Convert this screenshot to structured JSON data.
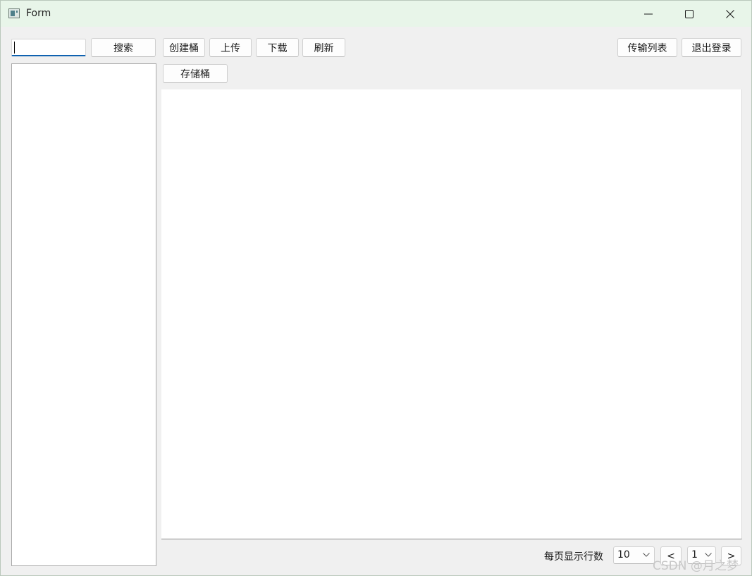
{
  "window": {
    "title": "Form",
    "icons": {
      "app": "app-icon",
      "minimize": "minimize-icon",
      "maximize": "maximize-icon",
      "close": "close-icon"
    }
  },
  "toolbar": {
    "search_value": "",
    "search_label": "搜索",
    "create_bucket_label": "创建桶",
    "upload_label": "上传",
    "download_label": "下载",
    "refresh_label": "刷新",
    "transfer_list_label": "传输列表",
    "logout_label": "退出登录"
  },
  "tabs": {
    "storage_bucket_label": "存储桶"
  },
  "sidebar": {
    "buckets": []
  },
  "table": {
    "rows": []
  },
  "pagination": {
    "rows_per_page_label": "每页显示行数",
    "rows_per_page_value": "10",
    "prev_label": "<",
    "page_value": "1",
    "next_label": ">"
  },
  "watermark": {
    "text": "CSDN @月之梦"
  },
  "colors": {
    "titlebar": "#e8f5e9",
    "window_bg": "#f0f0f0",
    "focus_underline": "#0f62b0"
  }
}
